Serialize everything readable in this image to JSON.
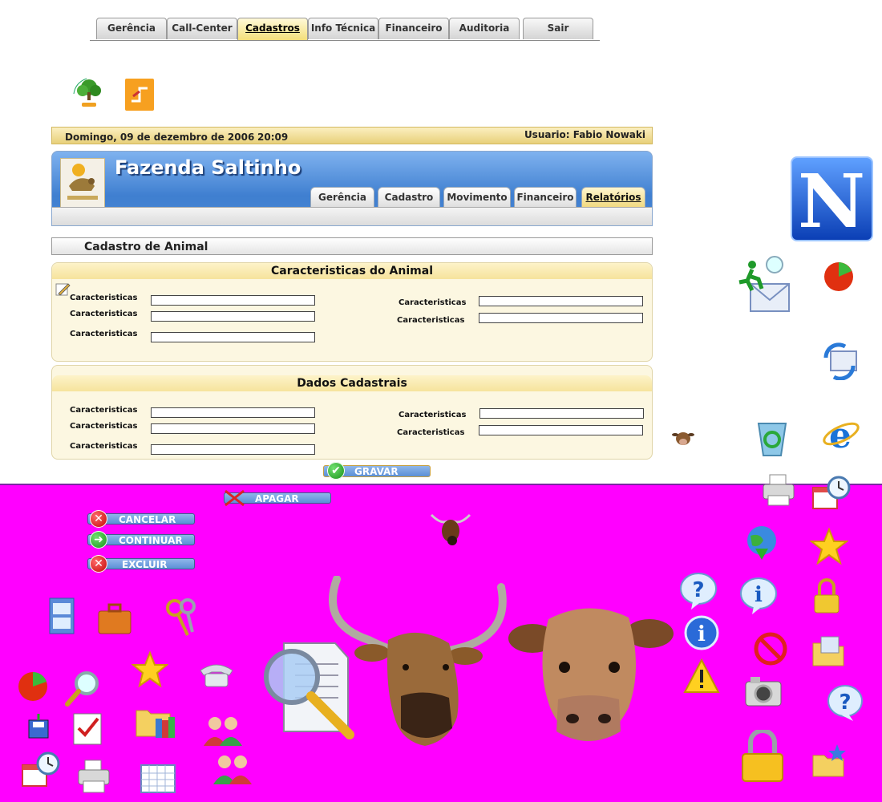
{
  "top_tabs": [
    "Gerência",
    "Call-Center",
    "Cadastros",
    "Info Técnica",
    "Financeiro",
    "Auditoria",
    "Sair"
  ],
  "top_active": "Cadastros",
  "datebar": {
    "date": "Domingo, 09 de dezembro de 2006",
    "time": "20:09",
    "user": "Usuario: Fabio Nowaki"
  },
  "header": {
    "farm_title": "Fazenda Saltinho",
    "tabs": [
      "Gerência",
      "Cadastro",
      "Movimento",
      "Financeiro",
      "Relatórios"
    ],
    "active_tab": "Relatórios"
  },
  "section_title": "Cadastro de Animal",
  "panel1": {
    "title": "Caracteristicas do Animal",
    "left_fields": [
      "Caracteristicas",
      "Caracteristicas",
      "Caracteristicas"
    ],
    "right_fields": [
      "Caracteristicas",
      "Caracteristicas"
    ]
  },
  "panel2": {
    "title": "Dados Cadastrais",
    "left_fields": [
      "Caracteristicas",
      "Caracteristicas",
      "Caracteristicas"
    ],
    "right_fields": [
      "Caracteristicas",
      "Caracteristicas"
    ]
  },
  "buttons": {
    "gravar": "GRAVAR",
    "apagar": "APAGAR",
    "cancelar": "CANCELAR",
    "continuar": "CONTINUAR",
    "excluir": "EXCLUIR"
  },
  "colors": {
    "magenta": "#ff00ff",
    "accent_blue": "#4a86d4",
    "panel_bg": "#fcf7e1"
  },
  "icons": [
    "netscape-n-icon",
    "run-mail-icon",
    "pie-chart-icon",
    "send-receive-icon",
    "recycle-bin-icon",
    "internet-explorer-icon",
    "cow-small-icon",
    "printer-icon",
    "calendar-clock-icon",
    "globe-download-icon",
    "star-icon",
    "help-bubble-icon",
    "info-bubble-icon",
    "padlock-icon",
    "info-icon",
    "no-entry-icon",
    "open-folder-icon",
    "warning-icon",
    "camera-icon",
    "question-icon",
    "large-padlock-icon",
    "star-folder-icon",
    "bull-head-icon",
    "cow-head-icon",
    "document-magnifier-icon",
    "file-cabinet-icon",
    "briefcase-icon",
    "keys-icon",
    "magnifier-icon",
    "telephone-icon",
    "save-disk-icon",
    "clipboard-check-icon",
    "folder-books-icon",
    "users-icon",
    "calendar-icon"
  ]
}
